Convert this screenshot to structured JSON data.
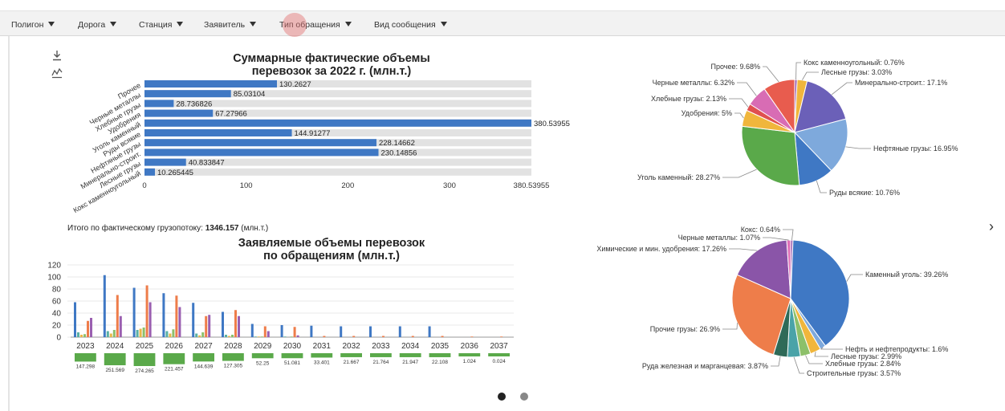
{
  "filters": [
    {
      "label": "Полигон"
    },
    {
      "label": "Дорога"
    },
    {
      "label": "Станция"
    },
    {
      "label": "Заявитель"
    },
    {
      "label": "Тип обращения"
    },
    {
      "label": "Вид сообщения"
    }
  ],
  "toolbar": {
    "download_icon": "download-icon",
    "chart_icon": "line-chart-icon"
  },
  "chart_data": [
    {
      "type": "bar",
      "orientation": "horizontal",
      "title": "Суммарные фактические объемы перевозок за 2022 г. (млн.т.)",
      "title_lines": [
        "Суммарные фактические объемы",
        "перевозок за 2022 г. (млн.т.)"
      ],
      "categories": [
        "Прочее",
        "Черные металлы",
        "Хлебные грузы",
        "Удобрения",
        "Уголь каменный",
        "Руды всякие",
        "Нефтяные грузы",
        "Минерально-строит.",
        "Лесные грузы",
        "Кокс каменноугольный"
      ],
      "values": [
        130.2627,
        85.03104,
        28.736826,
        67.27966,
        380.53955,
        144.91277,
        228.14662,
        230.14856,
        40.833847,
        10.265445
      ],
      "value_labels": [
        "130.2627",
        "85.03104",
        "28.736826",
        "67.27966",
        "380.53955",
        "144.91277",
        "228.14662",
        "230.14856",
        "40.833847",
        "10.265445"
      ],
      "xlim": [
        0,
        380.53955
      ],
      "xticks": [
        "0",
        "100",
        "200",
        "300",
        "380.53955"
      ],
      "bar_color": "#3f78c4",
      "track_color": "#e2e2e2",
      "total_label": "Итого по фактическому грузопотоку:",
      "total_value": "1346.157",
      "total_unit": "(млн.т.)"
    },
    {
      "type": "bar",
      "title": "Заявляемые объемы перевозок по обращениям (млн.т.)",
      "title_lines": [
        "Заявляемые объемы перевозок",
        "по обращениям (млн.т.)"
      ],
      "categories": [
        "2023",
        "2024",
        "2025",
        "2026",
        "2027",
        "2028",
        "2029",
        "2030",
        "2031",
        "2032",
        "2033",
        "2034",
        "2035",
        "2036",
        "2037"
      ],
      "ylim": [
        0,
        120
      ],
      "yticks": [
        "0",
        "20",
        "40",
        "60",
        "80",
        "100",
        "120"
      ],
      "series": [
        {
          "color": "#3f78c4",
          "values": [
            58,
            103,
            82,
            73,
            57,
            42,
            22,
            20,
            19,
            18,
            18,
            18,
            18,
            0,
            0
          ]
        },
        {
          "color": "#5ab0a4",
          "values": [
            8,
            10,
            12,
            10,
            6,
            4,
            1,
            1,
            0,
            0,
            0,
            0,
            0,
            0,
            0
          ]
        },
        {
          "color": "#e8b84a",
          "values": [
            4,
            6,
            14,
            6,
            3,
            2,
            1,
            0,
            0,
            0,
            0,
            0,
            0,
            0,
            0
          ]
        },
        {
          "color": "#8dc06a",
          "values": [
            5,
            12,
            16,
            13,
            8,
            4,
            1,
            1,
            0,
            0,
            0,
            0,
            0,
            0,
            0
          ]
        },
        {
          "color": "#ee7d4a",
          "values": [
            27,
            70,
            86,
            69,
            35,
            45,
            18,
            17,
            2,
            2,
            2,
            2,
            2,
            1,
            1
          ]
        },
        {
          "color": "#9a5fb0",
          "values": [
            32,
            35,
            58,
            50,
            37,
            35,
            10,
            3,
            0,
            0,
            0,
            0,
            0,
            0,
            0
          ]
        }
      ],
      "totals": [
        147.298,
        251.569,
        274.265,
        221.457,
        144.639,
        127.305,
        52.25,
        51.081,
        33.401,
        21.667,
        21.764,
        21.947,
        22.108,
        1.024,
        0.024
      ],
      "total_labels": [
        "147.298",
        "251.569",
        "274.265",
        "221.457",
        "144.639",
        "127.305",
        "52.25",
        "51.081",
        "33.401",
        "21.667",
        "21.764",
        "21.947",
        "22.108",
        "1.024",
        "0.024"
      ],
      "total_bar_color": "#5aa94a"
    },
    {
      "type": "pie",
      "slices": [
        {
          "label": "Кокс каменноугольный: 0.76%",
          "value": 0.76,
          "color": "#9a5fb0"
        },
        {
          "label": "Лесные грузы: 3.03%",
          "value": 3.03,
          "color": "#f0b63c"
        },
        {
          "label": "Минерально-строит.: 17.1%",
          "value": 17.1,
          "color": "#6b60b8"
        },
        {
          "label": "Нефтяные грузы: 16.95%",
          "value": 16.95,
          "color": "#7ea9dc"
        },
        {
          "label": "Руды всякие: 10.76%",
          "value": 10.76,
          "color": "#3f78c4"
        },
        {
          "label": "Уголь каменный: 28.27%",
          "value": 28.27,
          "color": "#5aa94a"
        },
        {
          "label": "Удобрения: 5%",
          "value": 5,
          "color": "#f0b63c"
        },
        {
          "label": "Хлебные грузы: 2.13%",
          "value": 2.13,
          "color": "#e05050"
        },
        {
          "label": "Черные металлы: 6.32%",
          "value": 6.32,
          "color": "#d86cb4"
        },
        {
          "label": "Прочее: 9.68%",
          "value": 9.68,
          "color": "#e85c4e"
        }
      ]
    },
    {
      "type": "pie",
      "slices": [
        {
          "label": "Кокс: 0.64%",
          "value": 0.64,
          "color": "#9a5fb0"
        },
        {
          "label": "Каменный уголь: 39.26%",
          "value": 39.26,
          "color": "#3f78c4"
        },
        {
          "label": "Нефть и нефтепродукты: 1.6%",
          "value": 1.6,
          "color": "#7ea9dc"
        },
        {
          "label": "Лесные грузы: 2.99%",
          "value": 2.99,
          "color": "#f0b63c"
        },
        {
          "label": "Хлебные грузы: 2.84%",
          "value": 2.84,
          "color": "#8dc06a"
        },
        {
          "label": "Строительные грузы: 3.57%",
          "value": 3.57,
          "color": "#4aa3a8"
        },
        {
          "label": "Руда железная и марганцевая: 3.87%",
          "value": 3.87,
          "color": "#2f6a58"
        },
        {
          "label": "Прочие грузы: 26.9%",
          "value": 26.9,
          "color": "#ee7d4a"
        },
        {
          "label": "Химические и мин. удобрения: 17.26%",
          "value": 17.26,
          "color": "#8a55a8"
        },
        {
          "label": "Черные металлы: 1.07%",
          "value": 1.07,
          "color": "#e070b8"
        }
      ]
    }
  ],
  "pager": {
    "next_icon": "chevron-right-icon",
    "next_glyph": "›",
    "dots": [
      "active",
      "inactive"
    ]
  }
}
